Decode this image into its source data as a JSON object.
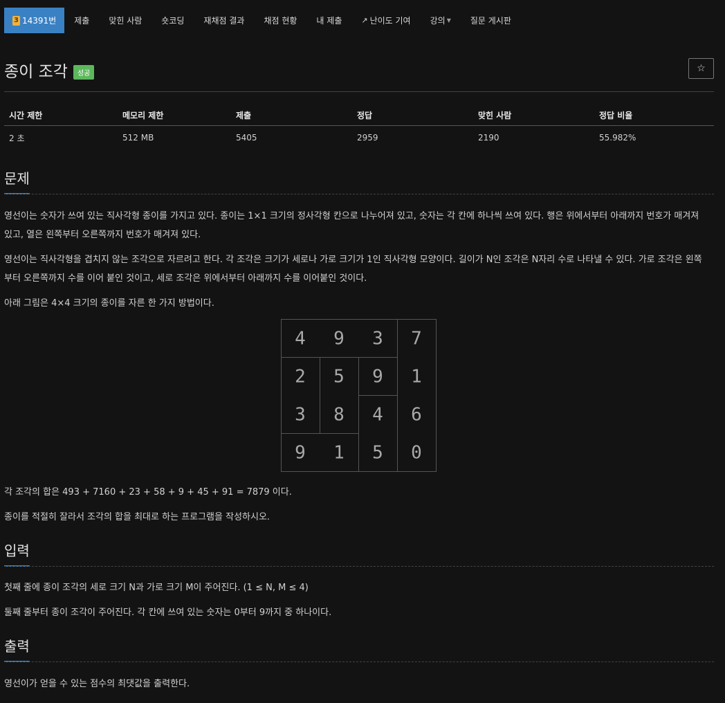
{
  "nav": {
    "problem_tier": "3",
    "problem_id": "14391번",
    "items": [
      "제출",
      "맞힌 사람",
      "숏코딩",
      "재채점 결과",
      "채점 현황",
      "내 제출",
      "난이도 기여",
      "강의",
      "질문 게시판"
    ]
  },
  "problem": {
    "title": "종이 조각",
    "result_badge": "성공",
    "star": "☆"
  },
  "info": {
    "headers": [
      "시간 제한",
      "메모리 제한",
      "제출",
      "정답",
      "맞힌 사람",
      "정답 비율"
    ],
    "values": [
      "2 초",
      "512 MB",
      "5405",
      "2959",
      "2190",
      "55.982%"
    ]
  },
  "sections": {
    "problem": "문제",
    "input": "입력",
    "output": "출력"
  },
  "text": {
    "p1": "영선이는 숫자가 쓰여 있는 직사각형 종이를 가지고 있다. 종이는 1×1 크기의 정사각형 칸으로 나누어져 있고, 숫자는 각 칸에 하나씩 쓰여 있다. 행은 위에서부터 아래까지 번호가 매겨져 있고, 열은 왼쪽부터 오른쪽까지 번호가 매겨져 있다.",
    "p2": "영선이는 직사각형을 겹치지 않는 조각으로 자르려고 한다. 각 조각은 크기가 세로나 가로 크기가 1인 직사각형 모양이다. 길이가 N인 조각은 N자리 수로 나타낼 수 있다. 가로 조각은 왼쪽부터 오른쪽까지 수를 이어 붙인 것이고, 세로 조각은 위에서부터 아래까지 수를 이어붙인 것이다.",
    "p3": "아래 그림은 4×4 크기의 종이를 자른 한 가지 방법이다.",
    "p4": "각 조각의 합은 493 + 7160 + 23 + 58 + 9 + 45 + 91 = 7879 이다.",
    "p5": "종이를 적절히 잘라서 조각의 합을 최대로 하는 프로그램을 작성하시오.",
    "in1": "첫째 줄에 종이 조각의 세로 크기 N과 가로 크기 M이 주어진다. (1 ≤ N, M ≤ 4)",
    "in2": "둘째 줄부터 종이 조각이 주어진다. 각 칸에 쓰여 있는 숫자는 0부터 9까지 중 하나이다.",
    "out1": "영선이가 얻을 수 있는 점수의 최댓값을 출력한다."
  },
  "grid": {
    "cells": [
      [
        "4",
        "9",
        "3",
        "7"
      ],
      [
        "2",
        "5",
        "9",
        "1"
      ],
      [
        "3",
        "8",
        "4",
        "6"
      ],
      [
        "9",
        "1",
        "5",
        "0"
      ]
    ]
  },
  "colors": {
    "accent": "#3a81c4",
    "tier": "#f1b23d",
    "success": "#5cb85c"
  }
}
